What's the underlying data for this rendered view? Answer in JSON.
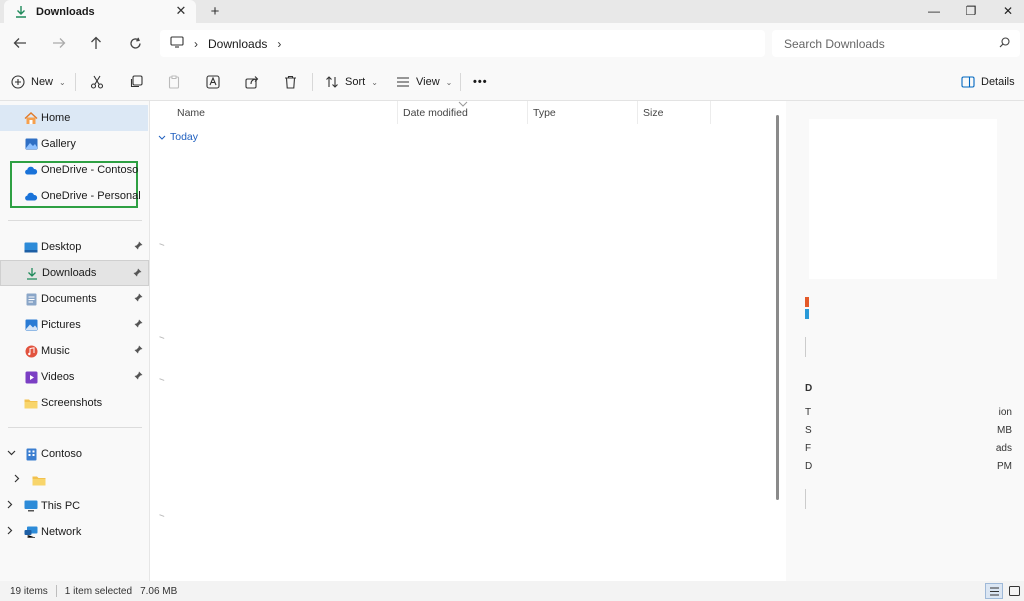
{
  "tab": {
    "label": "Downloads",
    "icon": "download-icon",
    "close_glyph": "✕"
  },
  "newtab_glyph": "+",
  "window_controls": {
    "minimize": "—",
    "maximize": "❐",
    "close": "✕"
  },
  "address": {
    "root_icon": "this-pc-icon",
    "sep": "›",
    "crumb": "Downloads"
  },
  "search": {
    "placeholder": "Search Downloads"
  },
  "commands": {
    "new": "New",
    "sort": "Sort",
    "view": "View",
    "more": "•••",
    "details": "Details"
  },
  "nav": {
    "home": "Home",
    "gallery": "Gallery",
    "onedrive_contoso": "OneDrive - Contoso",
    "onedrive_personal": "OneDrive - Personal",
    "desktop": "Desktop",
    "downloads": "Downloads",
    "documents": "Documents",
    "pictures": "Pictures",
    "music": "Music",
    "videos": "Videos",
    "screenshots": "Screenshots",
    "contoso": "Contoso",
    "this_pc": "This PC",
    "network": "Network"
  },
  "columns": {
    "name": "Name",
    "date_modified": "Date modified",
    "type": "Type",
    "size": "Size"
  },
  "group": {
    "label": "Today"
  },
  "details_fragments": {
    "heading": "D",
    "left": [
      "T",
      "S",
      "F",
      "D"
    ],
    "right": [
      "ion",
      "MB",
      "ads",
      "PM"
    ]
  },
  "status": {
    "items": "19 items",
    "selected": "1 item selected",
    "size": "7.06 MB"
  },
  "colors": {
    "accent": "#0067c0",
    "highlight_box": "#2ea043",
    "home_selected": "#dce8f5"
  }
}
